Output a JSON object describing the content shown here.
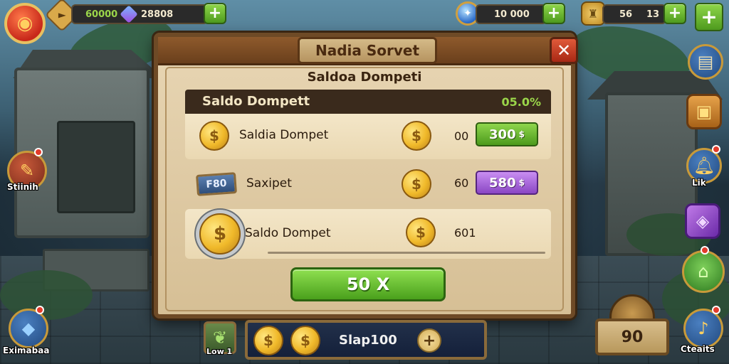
{
  "top_bar": {
    "gems": "60000",
    "coins": "28808",
    "mana": "10 000",
    "items_a": "56",
    "items_b": "13",
    "plus": "+"
  },
  "left_icons": [
    {
      "label": "Stiinih"
    },
    {
      "label": "Eximabaa"
    }
  ],
  "right_icons": [
    {
      "label": "Lik"
    },
    {
      "label": "Cteaits"
    }
  ],
  "dialog": {
    "title": "Nadia Sorvet",
    "subtitle": "Saldoa Dompeti",
    "close_label": "✕",
    "summary": {
      "title": "Saldo Dompett",
      "value": "05.0%"
    },
    "rows": [
      {
        "label": "Saldia Dompet",
        "qty": "00",
        "price": "300",
        "currency": "$",
        "coin_symbol": "$"
      },
      {
        "label": "Saxipet",
        "qty": "60",
        "price": "580",
        "currency": "$",
        "ticket": "F80",
        "coin_symbol": "$"
      },
      {
        "label": "Saldo Dompet",
        "qty": "601",
        "coin_symbol": "$"
      }
    ],
    "confirm_label": "50 X"
  },
  "bottom": {
    "label": "Slap100",
    "plus": "+",
    "badge_label": "Low 1",
    "coin_symbol": "$"
  },
  "score": {
    "value": "90"
  },
  "colors": {
    "green_btn": "#4c9a1c",
    "purple_btn": "#8a46c4",
    "dialog_frame": "#6e4a26",
    "close_btn": "#a82814"
  }
}
